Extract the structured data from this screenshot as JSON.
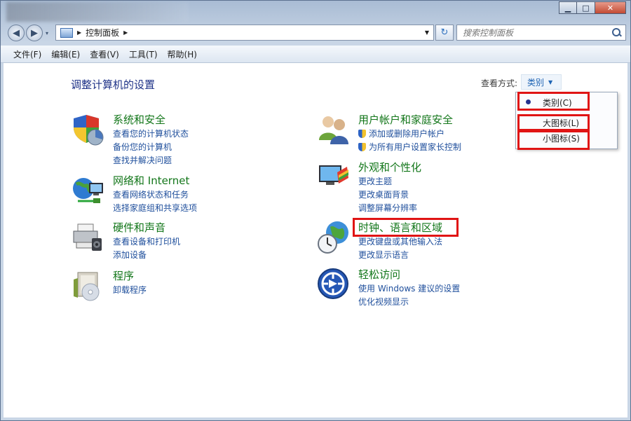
{
  "window": {
    "caption_buttons": {
      "minimize": "▁",
      "maximize": "□",
      "close": "✕"
    }
  },
  "nav": {
    "back": "◀",
    "forward": "▶",
    "history": "▾",
    "address": {
      "breadcrumb": "控制面板",
      "sep1": "▶",
      "sep2": "▶",
      "dropdown": "▼"
    },
    "refresh": "↻",
    "search_placeholder": "搜索控制面板"
  },
  "menubar": [
    "文件(F)",
    "编辑(E)",
    "查看(V)",
    "工具(T)",
    "帮助(H)"
  ],
  "content": {
    "heading": "调整计算机的设置",
    "view_by_label": "查看方式:",
    "view_by_value": "类别",
    "view_by_arrow": "▼"
  },
  "categories": [
    {
      "title": "系统和安全",
      "icon": "system-security-icon",
      "links": [
        "查看您的计算机状态",
        "备份您的计算机",
        "查找并解决问题"
      ]
    },
    {
      "title": "网络和 Internet",
      "icon": "network-icon",
      "links": [
        "查看网络状态和任务",
        "选择家庭组和共享选项"
      ]
    },
    {
      "title": "硬件和声音",
      "icon": "hardware-sound-icon",
      "links": [
        "查看设备和打印机",
        "添加设备"
      ]
    },
    {
      "title": "程序",
      "icon": "programs-icon",
      "links": [
        "卸载程序"
      ]
    },
    {
      "title": "用户帐户和家庭安全",
      "icon": "user-accounts-icon",
      "links": [
        "添加或删除用户帐户",
        "为所有用户设置家长控制"
      ]
    },
    {
      "title": "外观和个性化",
      "icon": "appearance-icon",
      "links": [
        "更改主题",
        "更改桌面背景",
        "调整屏幕分辨率"
      ]
    },
    {
      "title": "时钟、语言和区域",
      "icon": "clock-language-icon",
      "links": [
        "更改键盘或其他输入法",
        "更改显示语言"
      ]
    },
    {
      "title": "轻松访问",
      "icon": "ease-of-access-icon",
      "links": [
        "使用 Windows 建议的设置",
        "优化视频显示"
      ]
    }
  ],
  "view_dropdown": {
    "items": [
      "类别(C)",
      "大图标(L)",
      "小图标(S)"
    ],
    "selected": "类别(C)"
  },
  "colors": {
    "highlight": "#e01414",
    "category_title": "#127619",
    "link": "#1f4f9c",
    "heading": "#1e3287"
  }
}
